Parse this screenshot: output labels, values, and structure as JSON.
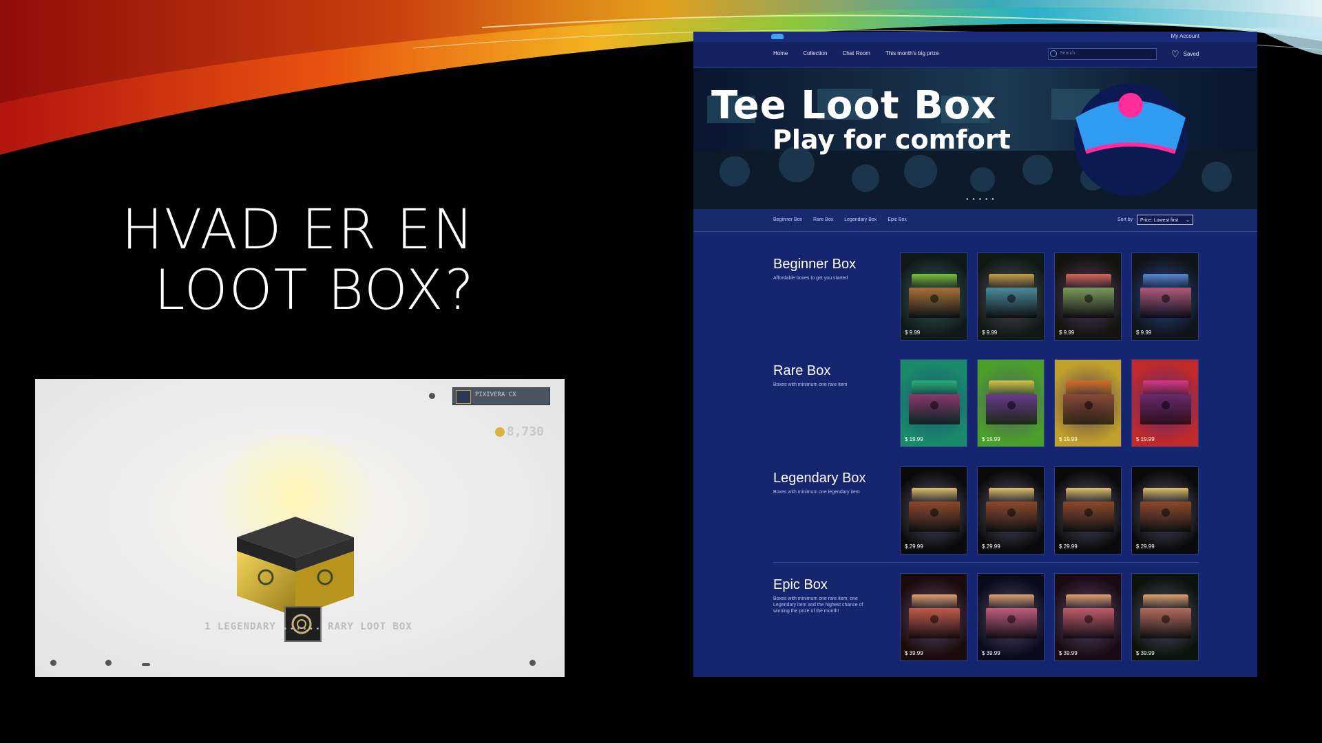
{
  "slide": {
    "title_line1": "HVAD ER EN",
    "title_line2": "LOOT BOX?"
  },
  "game": {
    "player_name": "PIXIVERA CX",
    "currency": "8,730",
    "caption": "1 LEGENDARY ...... RARY LOOT BOX"
  },
  "site": {
    "account_link": "My Account",
    "nav": [
      "Home",
      "Collection",
      "Chat Room",
      "This month's big prize"
    ],
    "search_placeholder": "Search",
    "saved_label": "Saved",
    "hero": {
      "title": "Tee Loot Box",
      "subtitle": "Play for comfort",
      "carousel_dots": "● ● ● ● ●"
    },
    "categories": [
      "Beginner Box",
      "Rare Box",
      "Legendary Box",
      "Epic Box"
    ],
    "sort_label": "Sort by",
    "sort_value": "Price: Lowest first",
    "sections": [
      {
        "name": "Beginner Box",
        "description": "Affordable boxes to get you started",
        "tiles": [
          {
            "price": "$ 9.99",
            "bg": "#0f1a18",
            "lid": "#7fc23d",
            "body": "#a8703a"
          },
          {
            "price": "$ 9.99",
            "bg": "#101a14",
            "lid": "#c9a04a",
            "body": "#4a8a9a"
          },
          {
            "price": "$ 9.99",
            "bg": "#14140f",
            "lid": "#d46a5a",
            "body": "#7a9a5a"
          },
          {
            "price": "$ 9.99",
            "bg": "#0f1418",
            "lid": "#5a8ad4",
            "body": "#b05a7a"
          }
        ]
      },
      {
        "name": "Rare Box",
        "description": "Boxes with minimum one rare item",
        "tiles": [
          {
            "price": "$ 19.99",
            "bg": "#1a8a6a",
            "lid": "#2ab07a",
            "body": "#8a3a6a"
          },
          {
            "price": "$ 19.99",
            "bg": "#4aa02a",
            "lid": "#d4c04a",
            "body": "#6a3a8a"
          },
          {
            "price": "$ 19.99",
            "bg": "#c0a02a",
            "lid": "#d46a2a",
            "body": "#8a4a3a"
          },
          {
            "price": "$ 19.99",
            "bg": "#c02a2a",
            "lid": "#d43a8a",
            "body": "#6a2a6a"
          }
        ]
      },
      {
        "name": "Legendary Box",
        "description": "Boxes with minimum one legendary item",
        "tiles": [
          {
            "price": "$ 29.99",
            "bg": "#0a0a0a",
            "lid": "#e0c070",
            "body": "#8a4a2a"
          },
          {
            "price": "$ 29.99",
            "bg": "#0a0a0a",
            "lid": "#e0c070",
            "body": "#8a4a2a"
          },
          {
            "price": "$ 29.99",
            "bg": "#0a0a0a",
            "lid": "#e0c070",
            "body": "#8a4a2a"
          },
          {
            "price": "$ 29.99",
            "bg": "#0a0a0a",
            "lid": "#e0c070",
            "body": "#8a4a2a"
          }
        ]
      },
      {
        "name": "Epic Box",
        "description": "Boxes with minimum one rare item, one Legendary item and the highest chance of winning the prize of the month!",
        "tiles": [
          {
            "price": "$ 39.99",
            "bg": "#1a0a0a",
            "lid": "#e0a070",
            "body": "#c05a4a"
          },
          {
            "price": "$ 39.99",
            "bg": "#0a0a1a",
            "lid": "#e0a070",
            "body": "#c05a7a"
          },
          {
            "price": "$ 39.99",
            "bg": "#1a0a14",
            "lid": "#e0a070",
            "body": "#c05a6a"
          },
          {
            "price": "$ 39.99",
            "bg": "#0a140a",
            "lid": "#e0a070",
            "body": "#b06a5a"
          }
        ]
      }
    ]
  },
  "colors": {
    "site_bg": "#152570",
    "hero_accent": "#2f9cf2",
    "hero_magenta": "#ff2d9b"
  }
}
